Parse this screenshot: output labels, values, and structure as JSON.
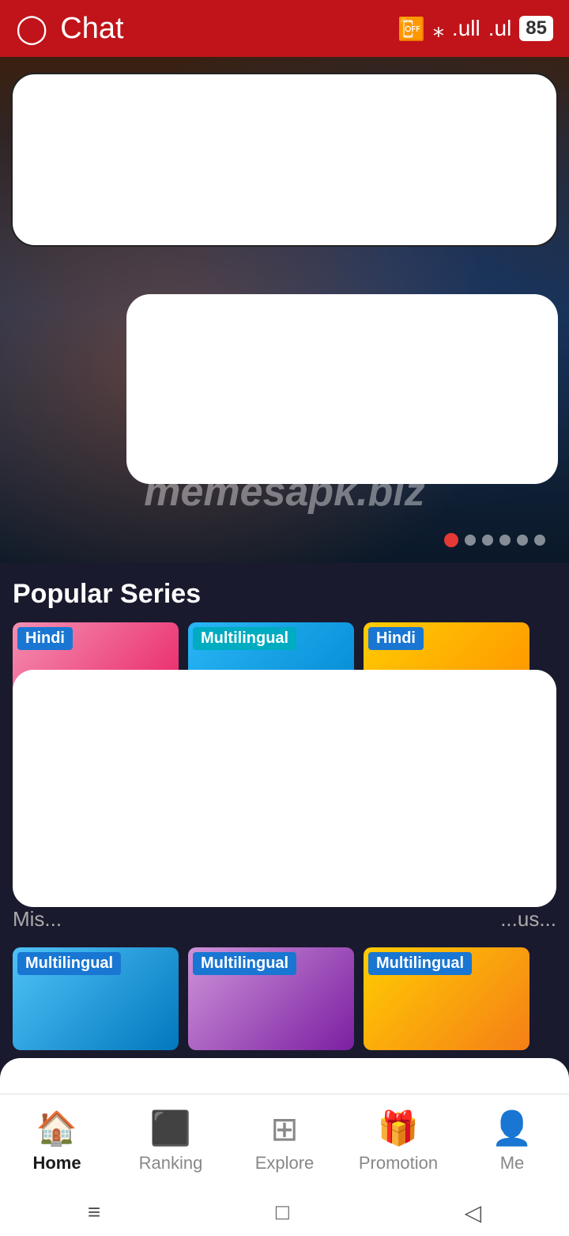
{
  "statusBar": {
    "title": "Chat",
    "battery": "85",
    "icons": [
      "vibrate",
      "wifi",
      "signal1",
      "signal2",
      "battery"
    ]
  },
  "hero": {
    "watermark": "memesapk.biz",
    "dots": [
      {
        "active": true
      },
      {
        "active": false
      },
      {
        "active": false
      },
      {
        "active": false
      },
      {
        "active": false
      },
      {
        "active": false
      }
    ]
  },
  "popularSeries": {
    "title": "Popular Series",
    "cards": [
      {
        "badge": "Hindi",
        "badgeClass": "badge-blue"
      },
      {
        "badge": "Multilingual",
        "badgeClass": "badge-cyan"
      },
      {
        "badge": "Hindi",
        "badgeClass": "badge-blue"
      }
    ],
    "truncatedLabels": [
      "Mis...",
      "...us..."
    ]
  },
  "secondRow": {
    "cards": [
      {
        "badge": "Multilingual",
        "badgeClass": "badge-blue"
      },
      {
        "badge": "Multilingual",
        "badgeClass": "badge-blue"
      },
      {
        "badge": "Multilingual",
        "badgeClass": "badge-blue"
      }
    ]
  },
  "bottomNav": {
    "items": [
      {
        "label": "Home",
        "active": true,
        "icon": "🏠"
      },
      {
        "label": "Ranking",
        "active": false,
        "icon": "📊"
      },
      {
        "label": "Explore",
        "active": false,
        "icon": "⊞"
      },
      {
        "label": "Promotion",
        "active": false,
        "icon": "🎁"
      },
      {
        "label": "Me",
        "active": false,
        "icon": "👤"
      }
    ]
  },
  "systemNav": {
    "buttons": [
      "≡",
      "□",
      "◁"
    ]
  }
}
